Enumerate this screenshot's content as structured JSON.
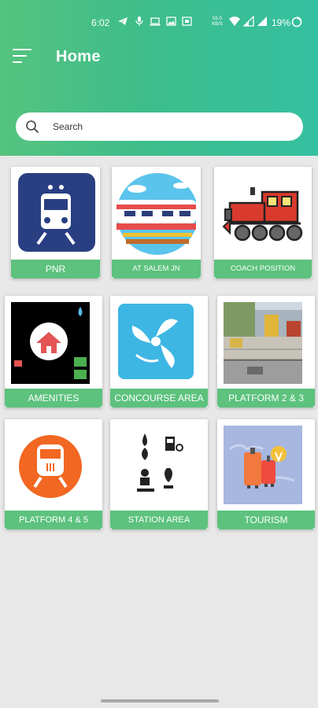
{
  "status_bar": {
    "time": "6:02",
    "data_speed": "55.0\nKB/S",
    "battery": "19%"
  },
  "header": {
    "title": "Home",
    "menu_icon": "hamburger-menu-icon",
    "gradient": [
      "#55c37e",
      "#35c0a0"
    ]
  },
  "search": {
    "placeholder": "Search",
    "icon": "search-icon"
  },
  "colors": {
    "label_bg": "#5cc27d",
    "page_bg": "#e8e8e8"
  },
  "tiles": [
    {
      "label": "PNR",
      "icon": "train-front-icon"
    },
    {
      "label": "AT SALEM JN",
      "icon": "train-side-icon"
    },
    {
      "label": "COACH POSITION",
      "icon": "locomotive-icon"
    },
    {
      "label": "AMENITIES",
      "icon": "amenities-icon"
    },
    {
      "label": "CONCOURSE AREA",
      "icon": "fan-icon"
    },
    {
      "label": "PLATFORM 2 & 3",
      "icon": "platform-photo"
    },
    {
      "label": "PLATFORM 4 & 5",
      "icon": "train-circle-icon"
    },
    {
      "label": "STATION  AREA",
      "icon": "station-facilities-icon"
    },
    {
      "label": "TOURISM",
      "icon": "travel-luggage-icon"
    }
  ]
}
